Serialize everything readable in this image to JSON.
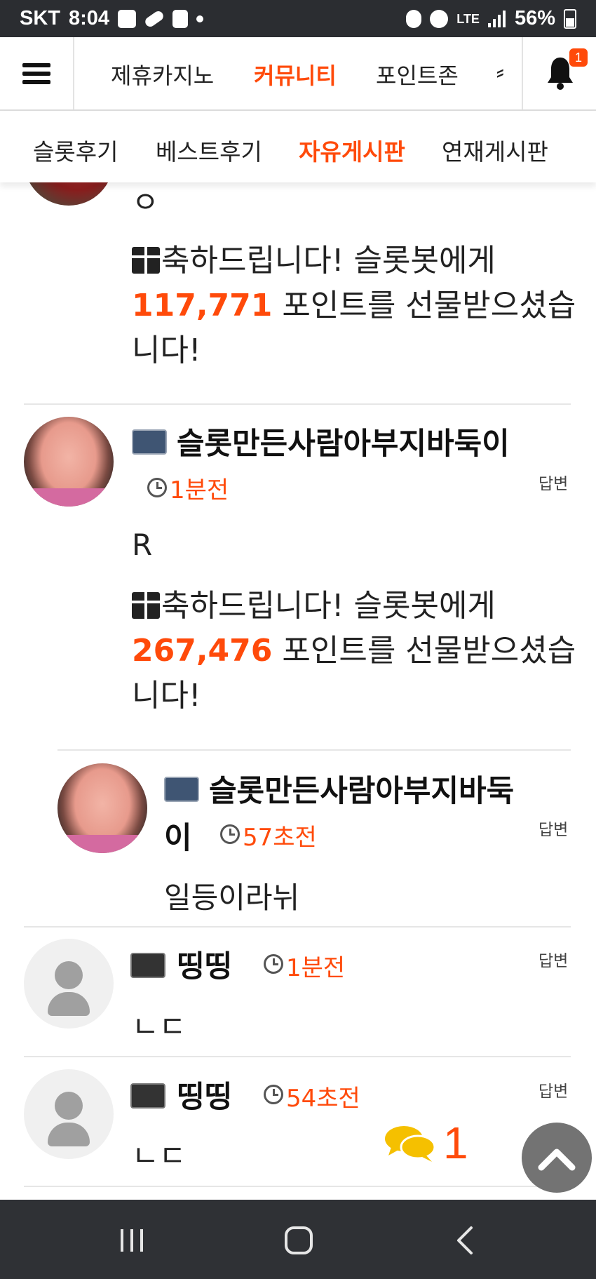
{
  "status_bar": {
    "carrier": "SKT",
    "time": "8:04",
    "network": "LTE",
    "battery": "56%"
  },
  "top_nav": {
    "items": [
      {
        "label": "제휴카지노",
        "active": false
      },
      {
        "label": "커뮤니티",
        "active": true
      },
      {
        "label": "포인트존",
        "active": false
      },
      {
        "label": "⸗",
        "active": false
      }
    ],
    "notification_count": "1"
  },
  "sub_nav": {
    "items": [
      {
        "label": "슬롯후기",
        "active": false
      },
      {
        "label": "베스트후기",
        "active": false
      },
      {
        "label": "자유게시판",
        "active": true
      },
      {
        "label": "연재게시판",
        "active": false
      }
    ]
  },
  "comments": [
    {
      "body": "ㅇ",
      "gift": {
        "prefix": "축하드립니다! 슬롯봇에게 ",
        "points": "117,771",
        "suffix": " 포인트를 선물받으셨습니다!"
      }
    },
    {
      "author": "슬롯만든사람아부지바둑이",
      "time": "1분전",
      "reply_label": "답변",
      "body": "R",
      "gift": {
        "prefix": "축하드립니다! 슬롯봇에게 ",
        "points": "267,476",
        "suffix": " 포인트를 선물받으셨습니다!"
      }
    },
    {
      "author_line1": "슬롯만든사람아부지바둑",
      "author_line2": "이",
      "time": "57초전",
      "reply_label": "답변",
      "body": "일등이라뉘"
    },
    {
      "author": "띵띵",
      "time": "1분전",
      "reply_label": "답변",
      "body": "ㄴㄷ"
    },
    {
      "author": "띵띵",
      "time": "54초전",
      "reply_label": "답변",
      "body": "ㄴㄷ"
    }
  ],
  "comment_count": "1",
  "colors": {
    "accent": "#ff4a0a",
    "status_bar": "#2b2d31",
    "nav_bar": "#2f3135"
  }
}
